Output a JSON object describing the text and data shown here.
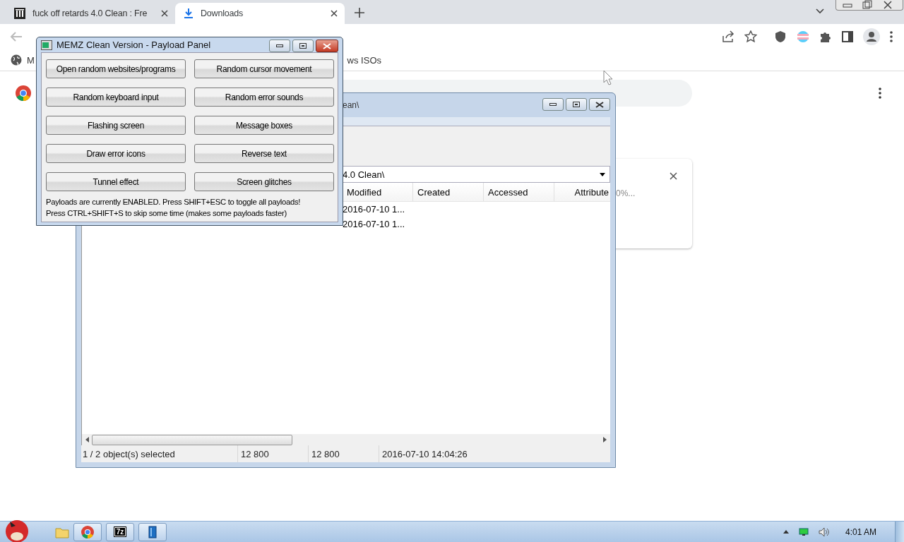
{
  "browser": {
    "tabs": [
      {
        "title": "fuck off retards 4.0 Clean : Fre",
        "kind": "archive",
        "selected": false
      },
      {
        "title": "Downloads",
        "kind": "download",
        "selected": true
      }
    ],
    "bookmarks": [
      {
        "label": "M"
      },
      {
        "label": "ws ISOs"
      }
    ],
    "download_card": {
      "progress_text": "0%..."
    }
  },
  "file_manager": {
    "title": "ean\\",
    "path": "4.0 Clean\\",
    "columns": [
      "Modified",
      "Created",
      "Accessed",
      "Attribute"
    ],
    "rows": [
      {
        "modified": "2016-07-10 1..."
      },
      {
        "modified": "2016-07-10 1..."
      }
    ],
    "status_bar": [
      "1 / 2 object(s) selected",
      "12 800",
      "12 800",
      "2016-07-10 14:04:26"
    ]
  },
  "payload_panel": {
    "title": "MEMZ Clean Version - Payload Panel",
    "buttons": [
      "Open random websites/programs",
      "Random cursor movement",
      "Random keyboard input",
      "Random error sounds",
      "Flashing screen",
      "Message boxes",
      "Draw error icons",
      "Reverse text",
      "Tunnel effect",
      "Screen glitches"
    ],
    "notes": [
      "Payloads are currently ENABLED. Press SHIFT+ESC to toggle all payloads!",
      "Press CTRL+SHIFT+S to skip some time (makes some payloads faster)"
    ]
  },
  "taskbar": {
    "apps": [
      {
        "kind": "folder"
      },
      {
        "kind": "chrome"
      },
      {
        "kind": "archiver",
        "label": "7z"
      },
      {
        "kind": "book"
      }
    ],
    "clock": "4:01 AM"
  }
}
